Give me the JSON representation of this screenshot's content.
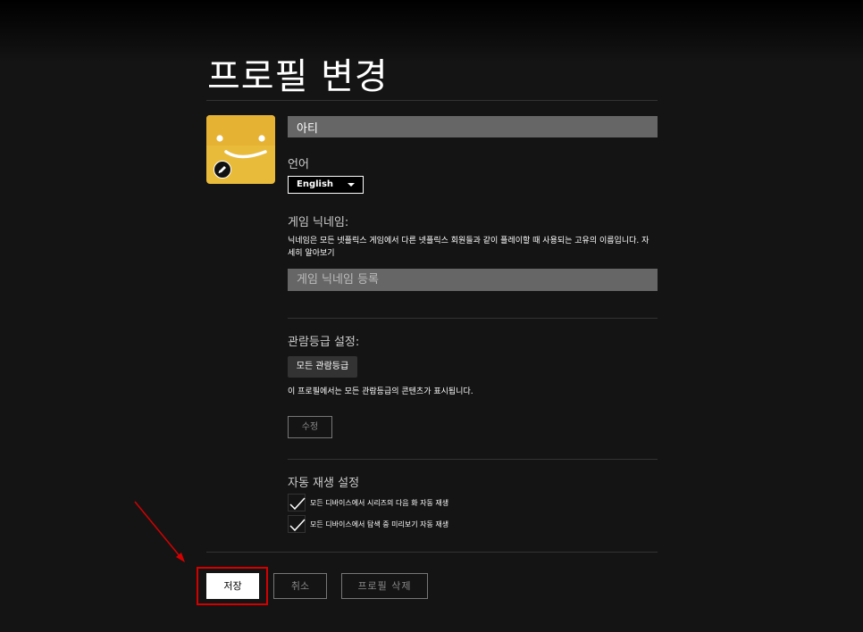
{
  "page": {
    "title": "프로필 변경"
  },
  "profile": {
    "name_value": "아티",
    "avatar_icon": "smiley-face-avatar",
    "avatar_color": "#e9bb3b",
    "edit_icon": "pencil-icon"
  },
  "language": {
    "label": "언어",
    "selected": "English"
  },
  "game_nickname": {
    "label": "게임 닉네임:",
    "description": "닉네임은 모든 넷플릭스 게임에서 다른 넷플릭스 회원들과 같이 플레이할 때 사용되는 고유의 이름입니다. 자세히 알아보기",
    "placeholder": "게임 닉네임 등록"
  },
  "maturity": {
    "label": "관람등급 설정:",
    "chip": "모든 관람등급",
    "description": "이 프로필에서는 모든 관람등급의 콘텐츠가 표시됩니다.",
    "edit_label": "수정"
  },
  "autoplay": {
    "label": "자동 재생 설정",
    "options": [
      {
        "label": "모든 디바이스에서 시리즈의 다음 화 자동 재생",
        "checked": true
      },
      {
        "label": "모든 디바이스에서 탐색 중 미리보기 자동 재생",
        "checked": true
      }
    ]
  },
  "actions": {
    "save": "저장",
    "cancel": "취소",
    "delete": "프로필 삭제"
  },
  "annotation": {
    "color": "#d40000"
  }
}
